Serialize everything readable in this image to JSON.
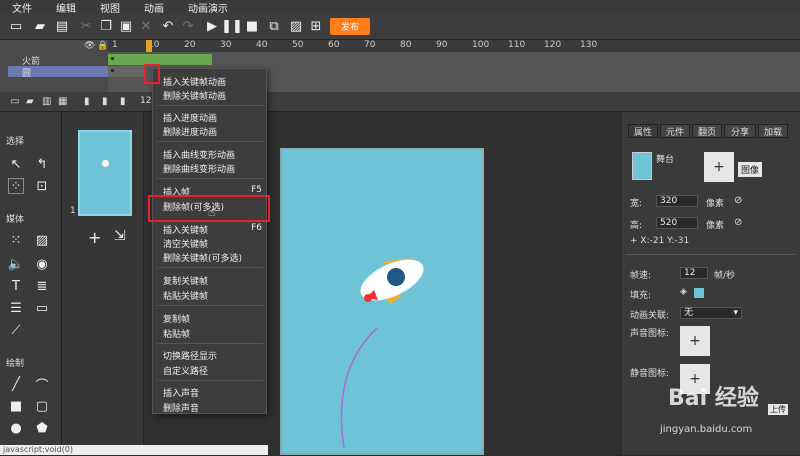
{
  "menubar": [
    "文件",
    "编辑",
    "视图",
    "动画",
    "动画演示"
  ],
  "toolbar": {
    "publish_label": "发布"
  },
  "timeline": {
    "ticks": [
      "1",
      "10",
      "20",
      "30",
      "40",
      "50",
      "60",
      "70",
      "80",
      "90",
      "100",
      "110",
      "120",
      "130"
    ],
    "layers": [
      "火箭",
      "圆"
    ],
    "frame_count": "12"
  },
  "left_tools": {
    "section_select": "选择",
    "section_media": "媒体",
    "section_draw": "绘制"
  },
  "pages": {
    "page_number": "1"
  },
  "context_menu": {
    "items": [
      {
        "label": "插入关键帧动画",
        "shortcut": ""
      },
      {
        "label": "删除关键帧动画",
        "shortcut": ""
      },
      {
        "label": "插入进度动画",
        "shortcut": ""
      },
      {
        "label": "删除进度动画",
        "shortcut": ""
      },
      {
        "label": "插入曲线变形动画",
        "shortcut": ""
      },
      {
        "label": "删除曲线变形动画",
        "shortcut": ""
      },
      {
        "label": "插入帧",
        "shortcut": "F5"
      },
      {
        "label": "删除帧(可多选)",
        "shortcut": ""
      },
      {
        "label": "插入关键帧",
        "shortcut": "F6"
      },
      {
        "label": "清空关键帧",
        "shortcut": ""
      },
      {
        "label": "删除关键帧(可多选)",
        "shortcut": ""
      },
      {
        "label": "复制关键帧",
        "shortcut": ""
      },
      {
        "label": "粘贴关键帧",
        "shortcut": ""
      },
      {
        "label": "复制帧",
        "shortcut": ""
      },
      {
        "label": "粘贴帧",
        "shortcut": ""
      },
      {
        "label": "切换路径显示",
        "shortcut": ""
      },
      {
        "label": "自定义路径",
        "shortcut": ""
      },
      {
        "label": "插入声音",
        "shortcut": ""
      },
      {
        "label": "删除声音",
        "shortcut": ""
      }
    ]
  },
  "props": {
    "tabs": [
      "属性",
      "元件",
      "翻页",
      "分享",
      "加载"
    ],
    "stage_label": "舞台",
    "image_button": "图像",
    "width_label": "宽:",
    "width_value": "320",
    "height_label": "高:",
    "height_value": "520",
    "unit": "像素",
    "coords": "+ X:-21   Y:-31",
    "fps_label": "帧速:",
    "fps_value": "12",
    "fps_unit": "帧/秒",
    "fill_label": "填充:",
    "anim_link_label": "动画关联:",
    "anim_link_value": "无",
    "sound_icon_label": "声音图标:",
    "mute_icon_label": "静音图标:",
    "upload": "上传",
    "fill_color": "#6ec4d6"
  },
  "status": "javascript:void(0)",
  "watermark": {
    "brand": "Bai 经验",
    "url": "jingyan.baidu.com"
  }
}
